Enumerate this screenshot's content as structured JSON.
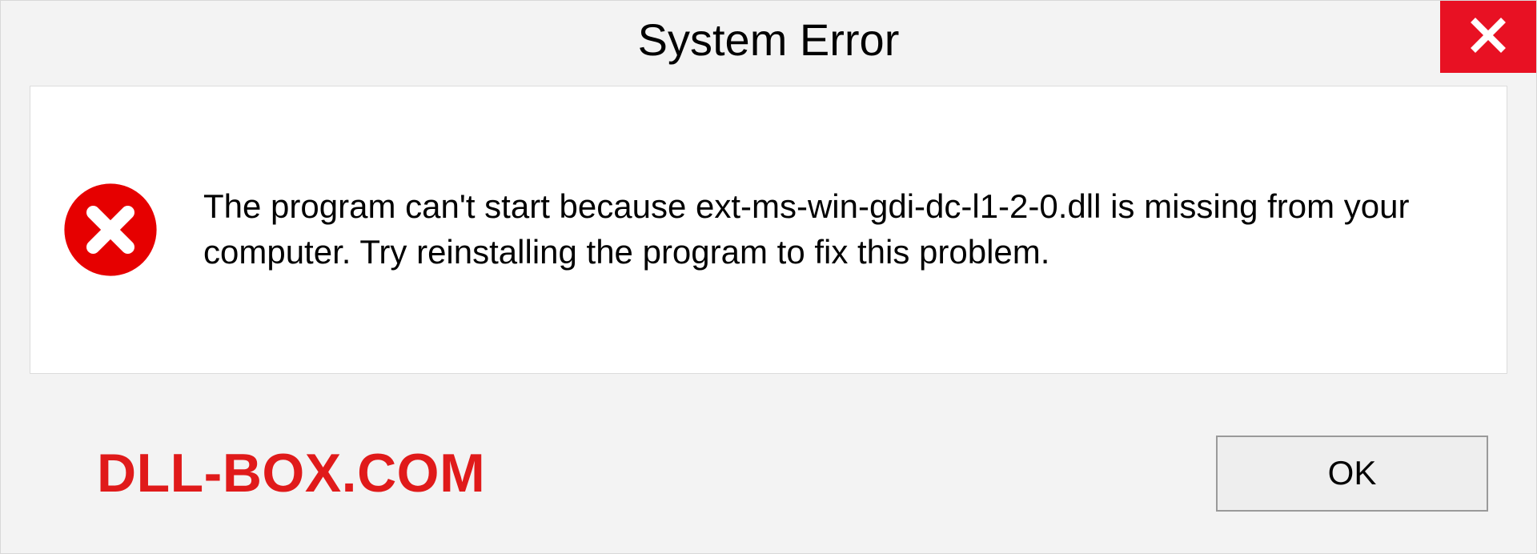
{
  "dialog": {
    "title": "System Error",
    "message": "The program can't start because ext-ms-win-gdi-dc-l1-2-0.dll is missing from your computer. Try reinstalling the program to fix this problem.",
    "ok_label": "OK",
    "watermark": "DLL-BOX.COM",
    "colors": {
      "close_bg": "#e81123",
      "error_icon": "#e60000",
      "watermark": "#e01a1a"
    },
    "icons": {
      "close": "close-icon",
      "error": "error-circle-x-icon"
    }
  }
}
